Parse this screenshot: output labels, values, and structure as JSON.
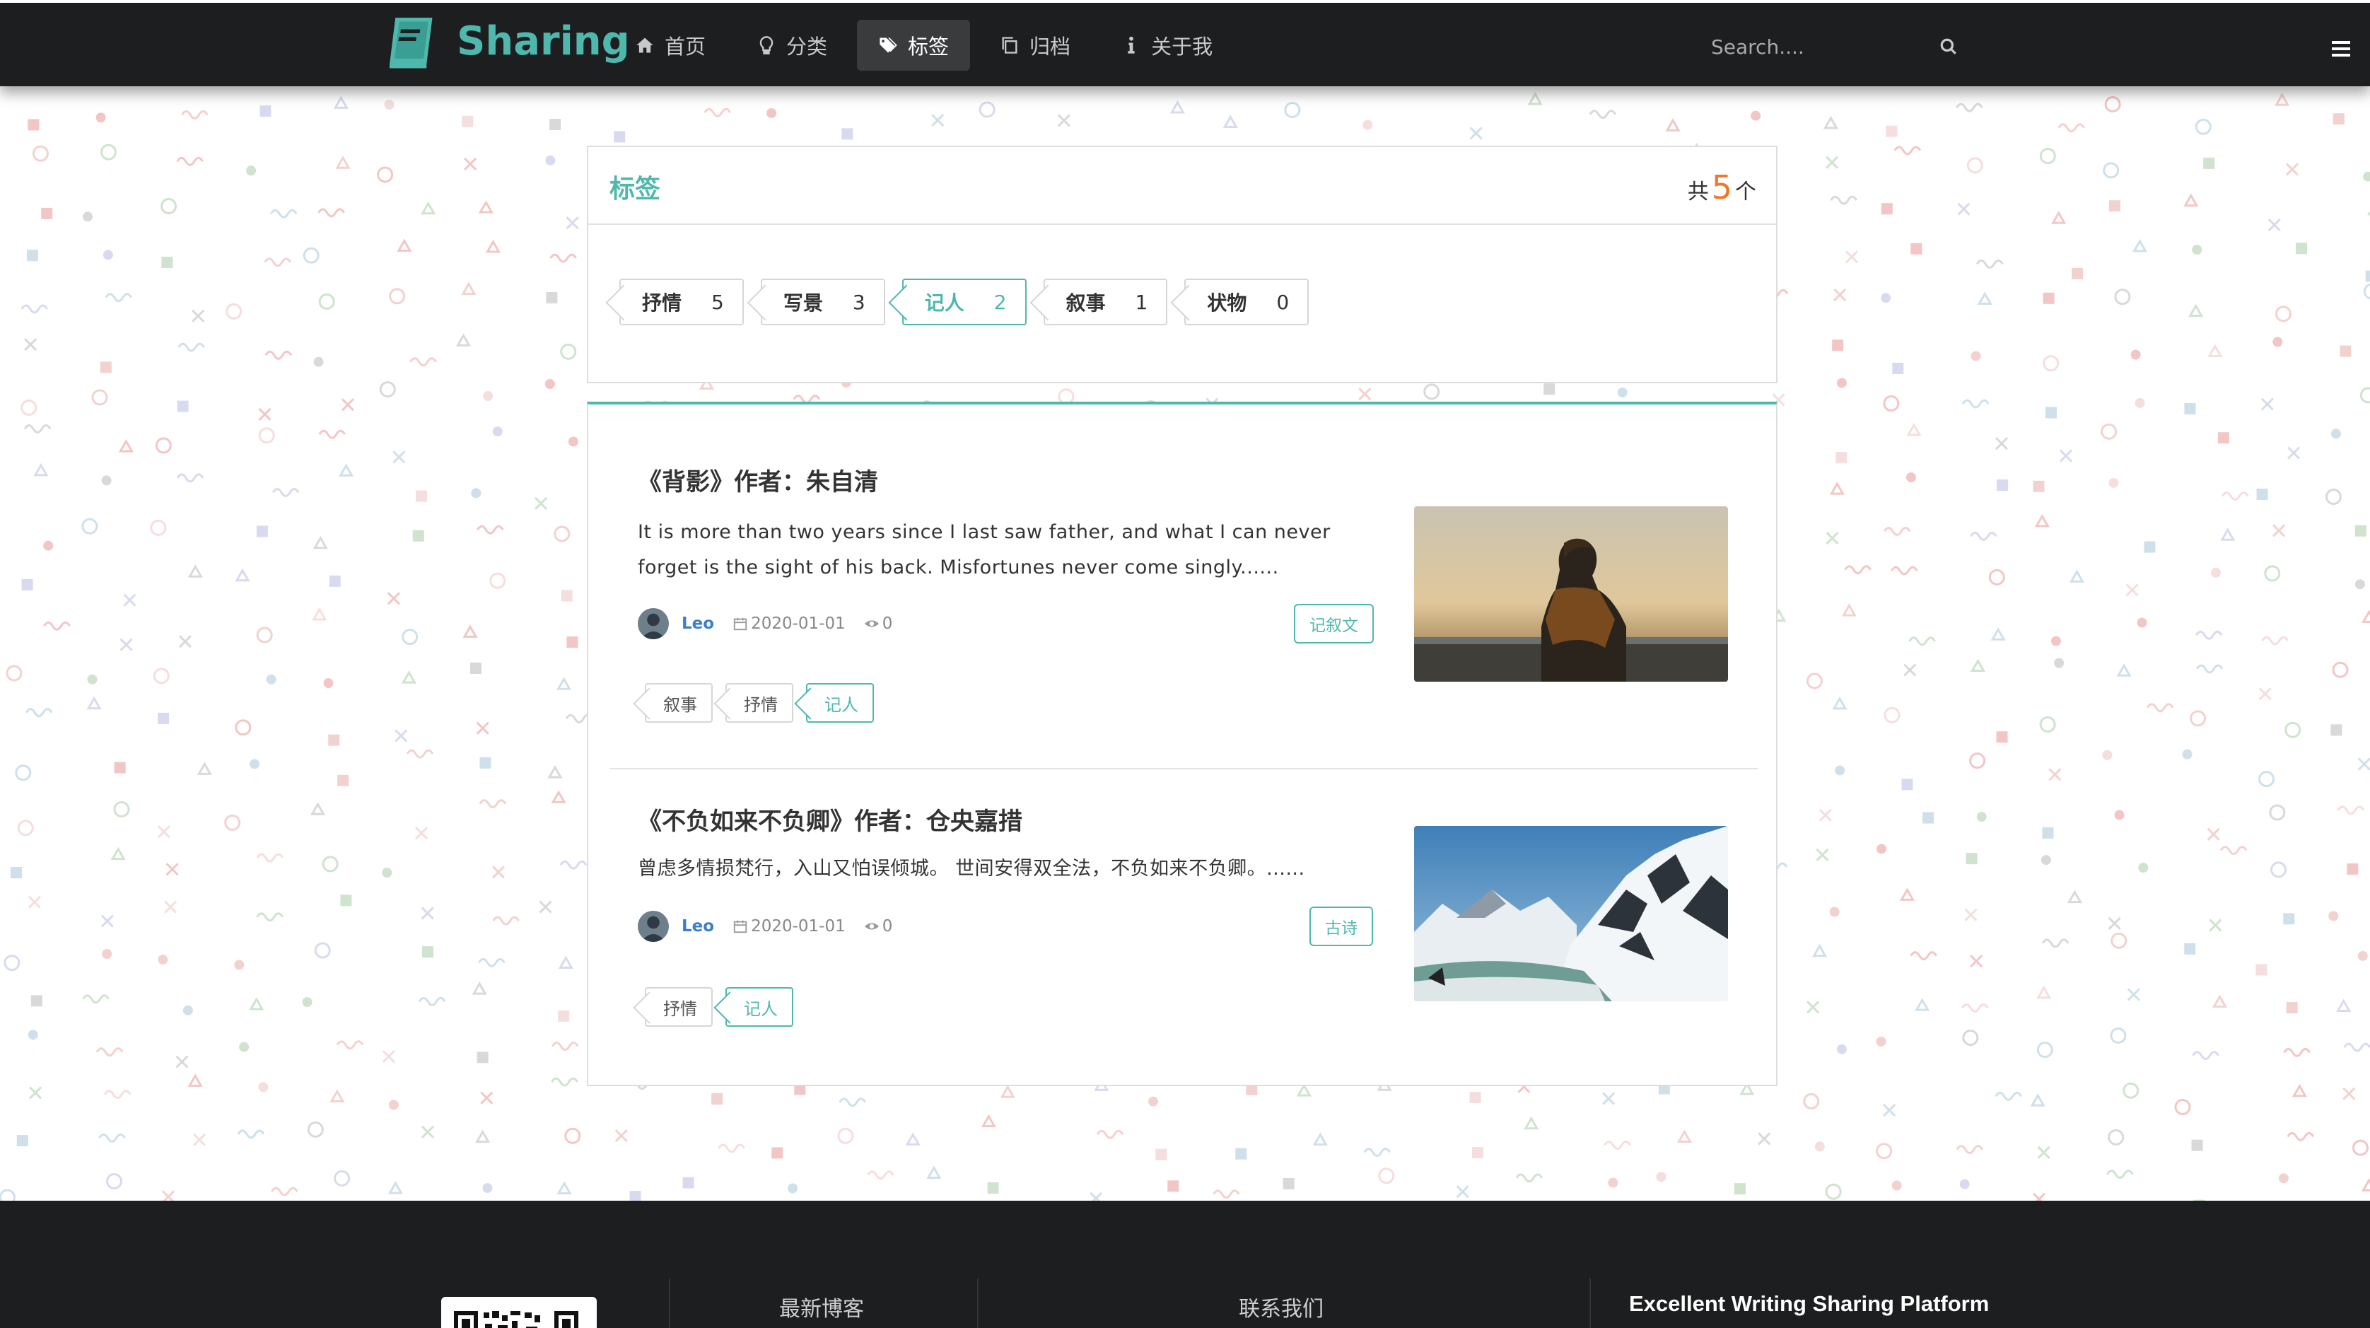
{
  "brand": {
    "name": "Sharing",
    "color": "#4fb8ad"
  },
  "nav": {
    "items": [
      {
        "label": "首页",
        "icon": "home-icon"
      },
      {
        "label": "分类",
        "icon": "lightbulb-icon"
      },
      {
        "label": "标签",
        "icon": "tags-icon",
        "active": true
      },
      {
        "label": "归档",
        "icon": "copy-icon"
      },
      {
        "label": "关于我",
        "icon": "info-icon"
      }
    ],
    "search_placeholder": "Search...."
  },
  "tag_panel": {
    "title": "标签",
    "count_prefix": "共",
    "count": "5",
    "count_suffix": "个",
    "tags": [
      {
        "name": "抒情",
        "count": "5"
      },
      {
        "name": "写景",
        "count": "3"
      },
      {
        "name": "记人",
        "count": "2",
        "active": true
      },
      {
        "name": "叙事",
        "count": "1"
      },
      {
        "name": "状物",
        "count": "0"
      }
    ]
  },
  "articles": [
    {
      "title": "《背影》作者：朱自清",
      "summary": "It is more than two years since I last saw father, and what I can never forget is the sight of his back. Misfortunes never come singly......",
      "author": "Leo",
      "date": "2020-01-01",
      "views": "0",
      "category": "记叙文",
      "tags": [
        {
          "name": "叙事"
        },
        {
          "name": "抒情"
        },
        {
          "name": "记人",
          "active": true
        }
      ],
      "image": "person-sunset-photo"
    },
    {
      "title": "《不负如来不负卿》作者：仓央嘉措",
      "summary": "曾虑多情损梵行，入山又怕误倾城。 世间安得双全法，不负如来不负卿。......",
      "author": "Leo",
      "date": "2020-01-01",
      "views": "0",
      "category": "古诗",
      "tags": [
        {
          "name": "抒情"
        },
        {
          "name": "记人",
          "active": true
        }
      ],
      "image": "snowy-mountain-photo"
    }
  ],
  "footer": {
    "col1": "最新博客",
    "col2": "联系我们",
    "col3": "Excellent Writing Sharing Platform"
  },
  "colors": {
    "accent": "#4fb8ad",
    "count": "#f0782a",
    "navbar": "#1d1e20",
    "link": "#3b7fc9"
  }
}
